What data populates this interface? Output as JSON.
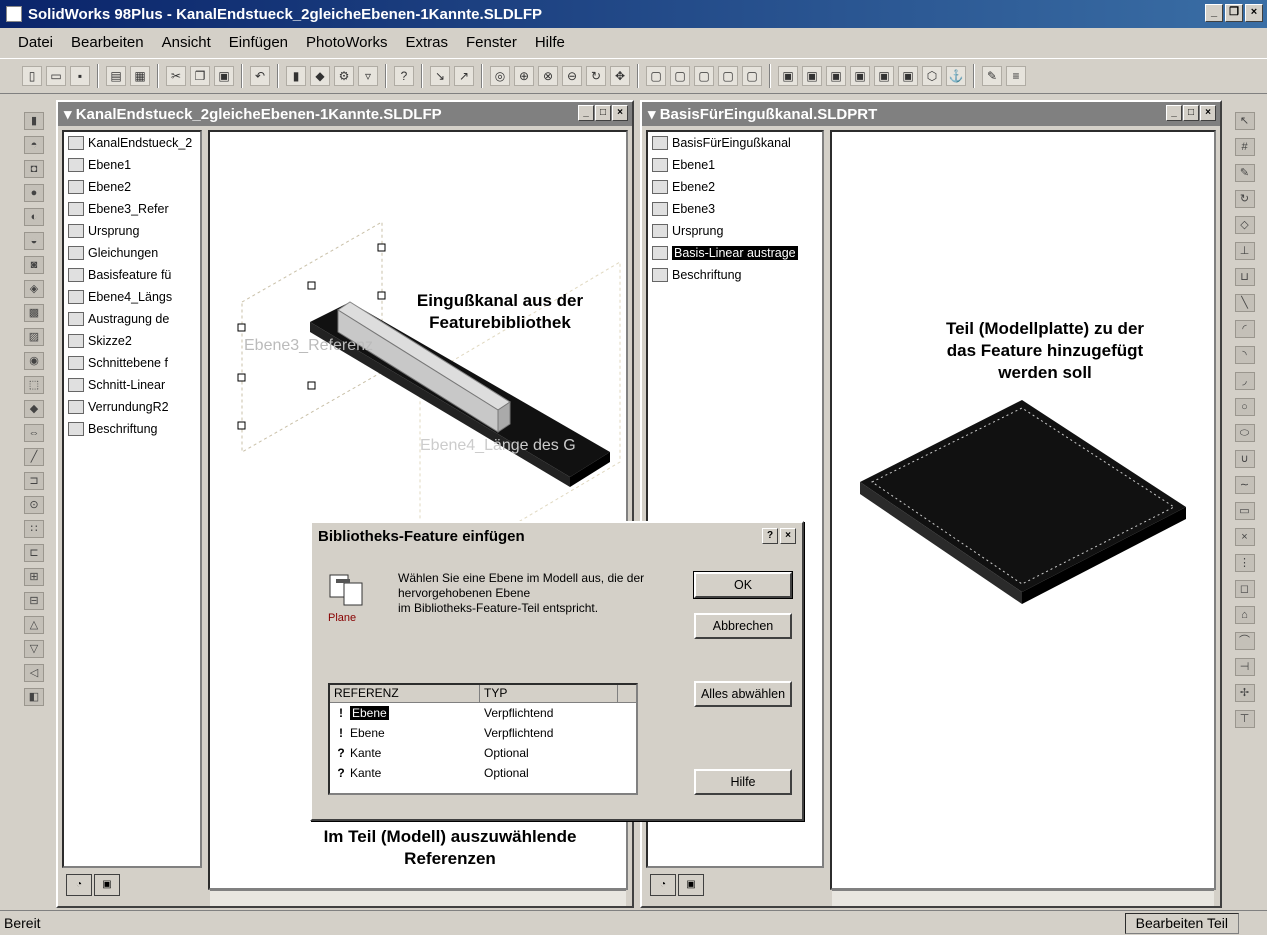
{
  "app": {
    "title": "SolidWorks 98Plus - KanalEndstueck_2gleicheEbenen-1Kannte.SLDLFP"
  },
  "menu": [
    "Datei",
    "Bearbeiten",
    "Ansicht",
    "Einfügen",
    "PhotoWorks",
    "Extras",
    "Fenster",
    "Hilfe"
  ],
  "window1": {
    "title": "KanalEndstueck_2gleicheEbenen-1Kannte.SLDLFP",
    "tree": [
      {
        "label": "KanalEndstueck_2",
        "icon": "library-part-icon"
      },
      {
        "label": "Ebene1",
        "icon": "plane-icon"
      },
      {
        "label": "Ebene2",
        "icon": "plane-icon"
      },
      {
        "label": "Ebene3_Refer",
        "icon": "plane-icon"
      },
      {
        "label": "Ursprung",
        "icon": "origin-icon"
      },
      {
        "label": "Gleichungen",
        "icon": "equations-icon"
      },
      {
        "label": "Basisfeature fü",
        "icon": "feature-icon"
      },
      {
        "label": "Ebene4_Längs",
        "icon": "plane-icon"
      },
      {
        "label": "Austragung de",
        "icon": "extrude-icon"
      },
      {
        "label": "Skizze2",
        "icon": "sketch-icon"
      },
      {
        "label": "Schnittebene f",
        "icon": "plane-icon"
      },
      {
        "label": "Schnitt-Linear",
        "icon": "cut-icon"
      },
      {
        "label": "VerrundungR2",
        "icon": "fillet-icon"
      },
      {
        "label": "Beschriftung",
        "icon": "annotation-icon"
      }
    ],
    "canvas_labels": {
      "plane_a": "Ebene3_Referenz",
      "plane_b": "Ebene4_Länge des G"
    }
  },
  "window2": {
    "title": "BasisFürEingußkanal.SLDPRT",
    "tree": [
      {
        "label": "BasisFürEingußkanal",
        "icon": "part-icon"
      },
      {
        "label": "Ebene1",
        "icon": "plane-icon"
      },
      {
        "label": "Ebene2",
        "icon": "plane-icon"
      },
      {
        "label": "Ebene3",
        "icon": "plane-icon"
      },
      {
        "label": "Ursprung",
        "icon": "origin-icon"
      },
      {
        "label": "Basis-Linear austrage",
        "icon": "extrude-icon",
        "selected": true
      },
      {
        "label": "Beschriftung",
        "icon": "annotation-icon"
      }
    ]
  },
  "annotations": {
    "eingusskanal": "Eingußkanal aus der\nFeaturebibliothek",
    "teil": "Teil (Modellplatte) zu der\ndas Feature hinzugefügt\nwerden soll",
    "referenzen": "Im Teil (Modell) auszuwählende\nReferenzen"
  },
  "dialog": {
    "title": "Bibliotheks-Feature einfügen",
    "icon_label": "Plane",
    "message": "Wählen Sie eine Ebene im Modell aus, die der\nhervorgehobenen Ebene\n im Bibliotheks-Feature-Teil entspricht.",
    "buttons": {
      "ok": "OK",
      "cancel": "Abbrechen",
      "deselect": "Alles abwählen",
      "help": "Hilfe"
    },
    "table": {
      "headers": [
        "REFERENZ",
        "TYP"
      ],
      "rows": [
        {
          "ref": "Ebene",
          "type": "Verpflichtend",
          "mark": "!",
          "selected": true
        },
        {
          "ref": "Ebene",
          "type": "Verpflichtend",
          "mark": "!"
        },
        {
          "ref": "Kante",
          "type": "Optional",
          "mark": "?"
        },
        {
          "ref": "Kante",
          "type": "Optional",
          "mark": "?"
        }
      ]
    }
  },
  "status": {
    "left": "Bereit",
    "right": "Bearbeiten Teil"
  }
}
